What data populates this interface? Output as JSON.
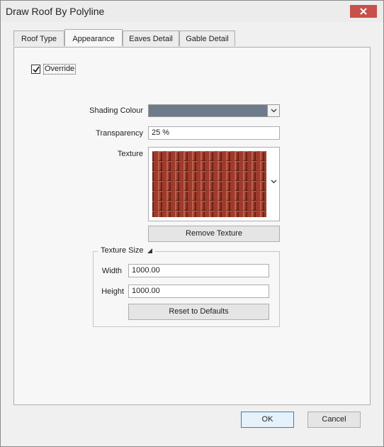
{
  "window": {
    "title": "Draw Roof By Polyline"
  },
  "tabs": [
    {
      "label": "Roof Type"
    },
    {
      "label": "Appearance"
    },
    {
      "label": "Eaves Detail"
    },
    {
      "label": "Gable Detail"
    }
  ],
  "appearance": {
    "override_label": "Override",
    "override_checked": true,
    "shading_colour_label": "Shading Colour",
    "shading_colour": "#6e7b8b",
    "transparency_label": "Transparency",
    "transparency_value": "25 %",
    "texture_label": "Texture",
    "remove_texture_label": "Remove Texture",
    "texture_size": {
      "title": "Texture Size",
      "width_label": "Width",
      "width_value": "1000.00",
      "height_label": "Height",
      "height_value": "1000.00",
      "reset_label": "Reset to Defaults"
    }
  },
  "footer": {
    "ok_label": "OK",
    "cancel_label": "Cancel"
  },
  "colors": {
    "close_button": "#c7504b",
    "tile_base": "#9e3b2c",
    "tile_shadow": "#6a2418",
    "tile_highlight": "#c0614c"
  }
}
